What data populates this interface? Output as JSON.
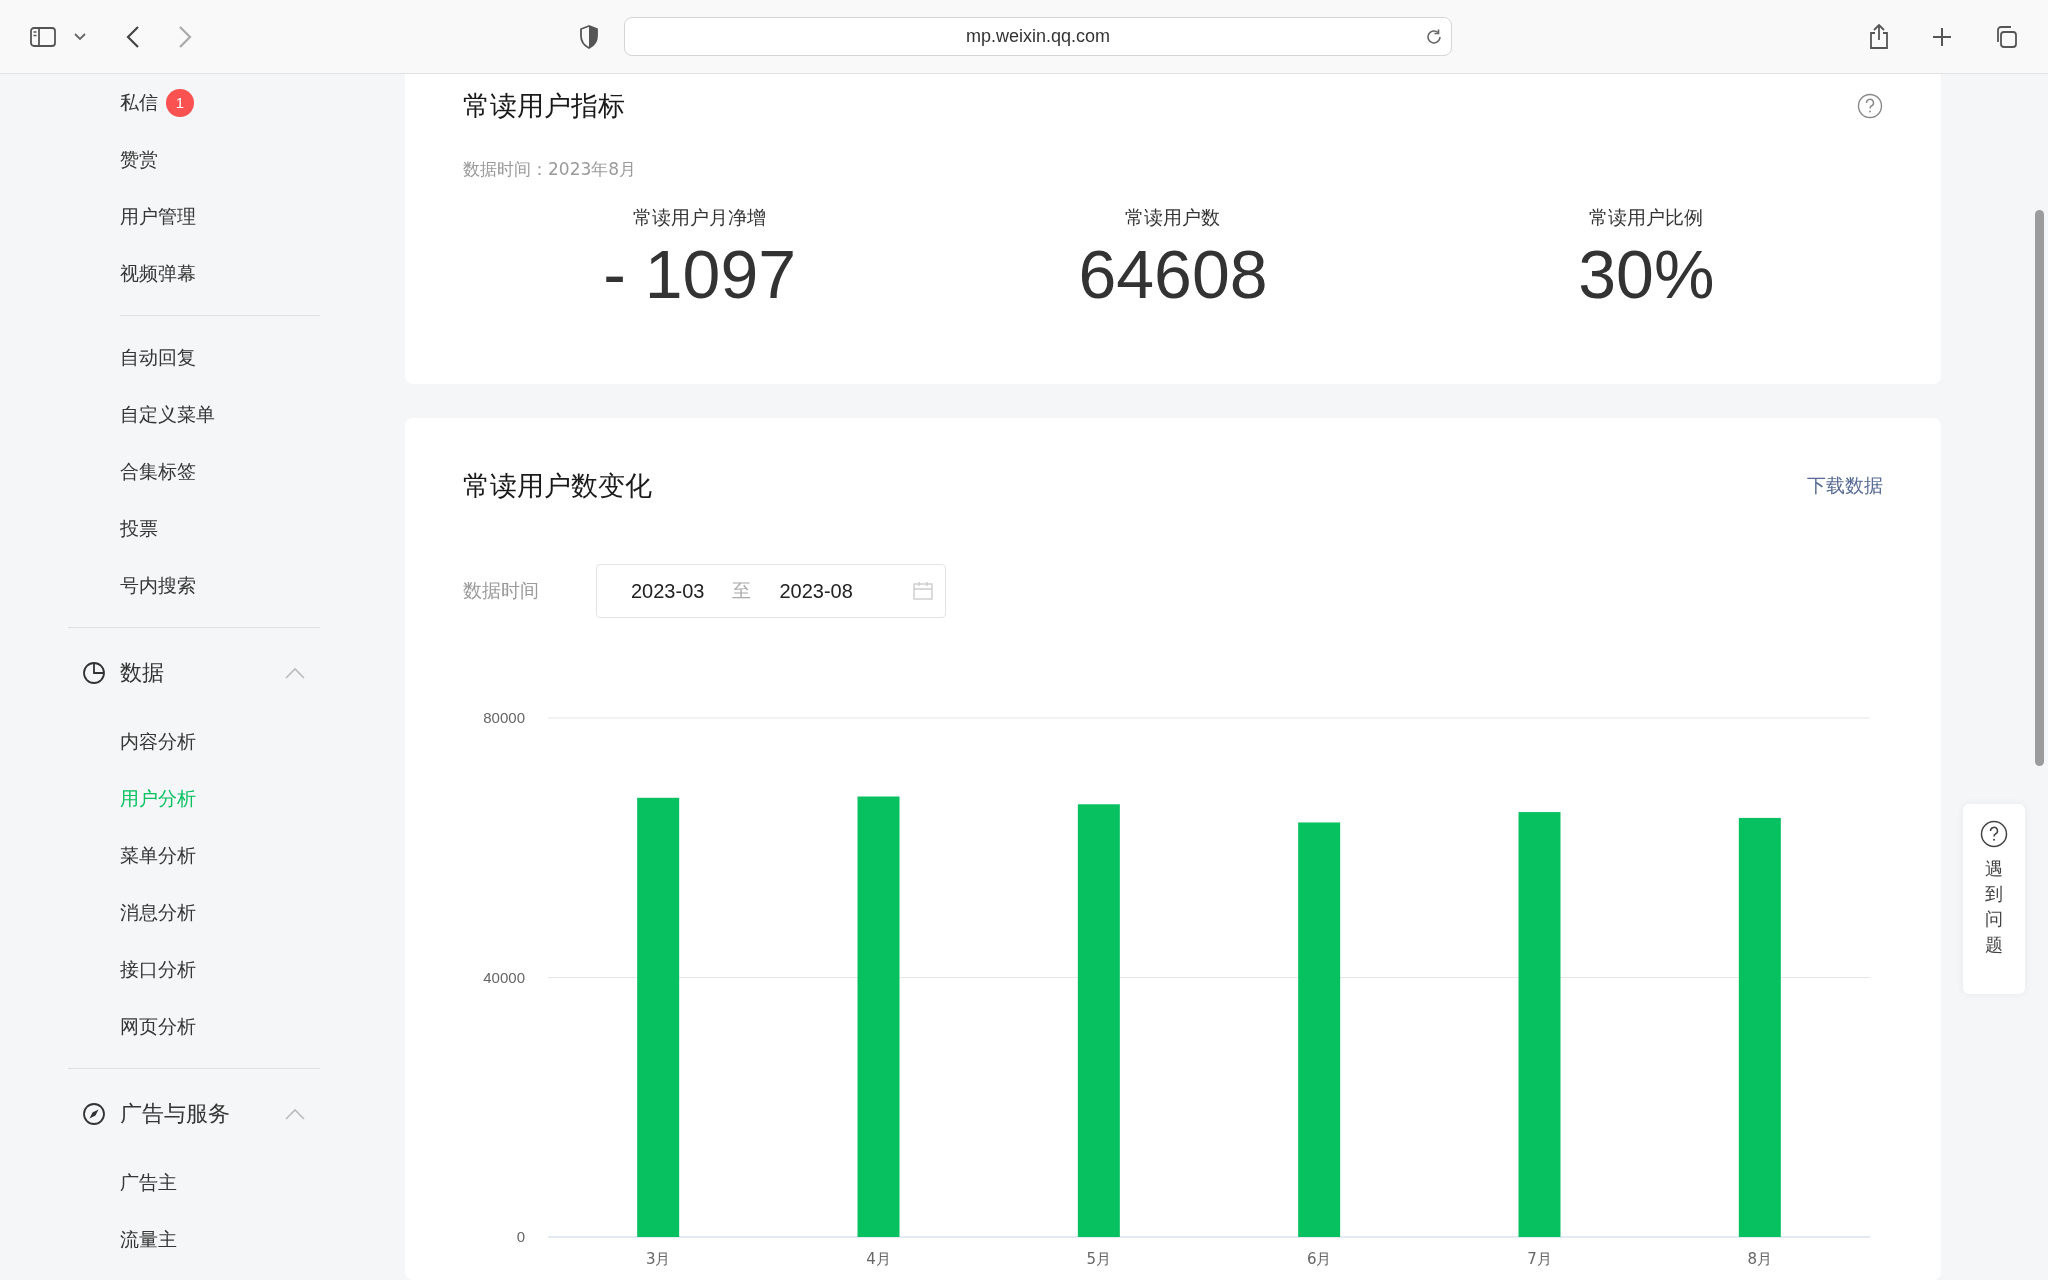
{
  "browser": {
    "url": "mp.weixin.qq.com"
  },
  "sidebar": {
    "sections": [
      {
        "items": [
          {
            "label": "私信",
            "selected": false,
            "badge": "1"
          },
          {
            "label": "赞赏",
            "selected": false
          },
          {
            "label": "用户管理",
            "selected": false
          },
          {
            "label": "视频弹幕",
            "selected": false
          }
        ]
      },
      {
        "items": [
          {
            "label": "自动回复",
            "selected": false
          },
          {
            "label": "自定义菜单",
            "selected": false
          },
          {
            "label": "合集标签",
            "selected": false
          },
          {
            "label": "投票",
            "selected": false
          },
          {
            "label": "号内搜索",
            "selected": false
          }
        ]
      },
      {
        "title": "数据",
        "expanded": true,
        "items": [
          {
            "label": "内容分析",
            "selected": false
          },
          {
            "label": "用户分析",
            "selected": true
          },
          {
            "label": "菜单分析",
            "selected": false
          },
          {
            "label": "消息分析",
            "selected": false
          },
          {
            "label": "接口分析",
            "selected": false
          },
          {
            "label": "网页分析",
            "selected": false
          }
        ]
      },
      {
        "title": "广告与服务",
        "expanded": true,
        "items": [
          {
            "label": "广告主",
            "selected": false
          },
          {
            "label": "流量主",
            "selected": false
          }
        ]
      }
    ]
  },
  "metrics_card": {
    "title": "常读用户指标",
    "date": "数据时间：2023年8月",
    "metrics": [
      {
        "label": "常读用户月净增",
        "value": "- 1097"
      },
      {
        "label": "常读用户数",
        "value": "64608"
      },
      {
        "label": "常读用户比例",
        "value": "30%"
      }
    ]
  },
  "trend_card": {
    "title": "常读用户数变化",
    "download": "下载数据",
    "date_label": "数据时间",
    "start": "2023-03",
    "separator": "至",
    "end": "2023-08",
    "chart_data": {
      "type": "bar",
      "categories": [
        "3月",
        "4月",
        "5月",
        "6月",
        "7月",
        "8月"
      ],
      "series": [
        {
          "color": "#07c160",
          "values": [
            67700,
            67900,
            66700,
            63900,
            65500,
            64600
          ]
        }
      ],
      "ylim": [
        0,
        80000
      ],
      "yticks": [
        0,
        40000,
        80000
      ]
    }
  },
  "help_panel": {
    "label": "遇到问题"
  }
}
